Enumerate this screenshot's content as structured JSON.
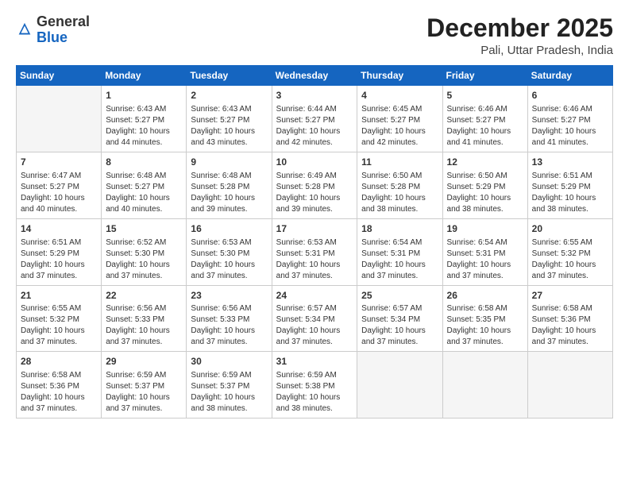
{
  "header": {
    "logo_general": "General",
    "logo_blue": "Blue",
    "month_title": "December 2025",
    "location": "Pali, Uttar Pradesh, India"
  },
  "weekdays": [
    "Sunday",
    "Monday",
    "Tuesday",
    "Wednesday",
    "Thursday",
    "Friday",
    "Saturday"
  ],
  "weeks": [
    [
      {
        "day": "",
        "empty": true
      },
      {
        "day": "1",
        "sunrise": "Sunrise: 6:43 AM",
        "sunset": "Sunset: 5:27 PM",
        "daylight": "Daylight: 10 hours and 44 minutes."
      },
      {
        "day": "2",
        "sunrise": "Sunrise: 6:43 AM",
        "sunset": "Sunset: 5:27 PM",
        "daylight": "Daylight: 10 hours and 43 minutes."
      },
      {
        "day": "3",
        "sunrise": "Sunrise: 6:44 AM",
        "sunset": "Sunset: 5:27 PM",
        "daylight": "Daylight: 10 hours and 42 minutes."
      },
      {
        "day": "4",
        "sunrise": "Sunrise: 6:45 AM",
        "sunset": "Sunset: 5:27 PM",
        "daylight": "Daylight: 10 hours and 42 minutes."
      },
      {
        "day": "5",
        "sunrise": "Sunrise: 6:46 AM",
        "sunset": "Sunset: 5:27 PM",
        "daylight": "Daylight: 10 hours and 41 minutes."
      },
      {
        "day": "6",
        "sunrise": "Sunrise: 6:46 AM",
        "sunset": "Sunset: 5:27 PM",
        "daylight": "Daylight: 10 hours and 41 minutes."
      }
    ],
    [
      {
        "day": "7",
        "sunrise": "Sunrise: 6:47 AM",
        "sunset": "Sunset: 5:27 PM",
        "daylight": "Daylight: 10 hours and 40 minutes."
      },
      {
        "day": "8",
        "sunrise": "Sunrise: 6:48 AM",
        "sunset": "Sunset: 5:27 PM",
        "daylight": "Daylight: 10 hours and 40 minutes."
      },
      {
        "day": "9",
        "sunrise": "Sunrise: 6:48 AM",
        "sunset": "Sunset: 5:28 PM",
        "daylight": "Daylight: 10 hours and 39 minutes."
      },
      {
        "day": "10",
        "sunrise": "Sunrise: 6:49 AM",
        "sunset": "Sunset: 5:28 PM",
        "daylight": "Daylight: 10 hours and 39 minutes."
      },
      {
        "day": "11",
        "sunrise": "Sunrise: 6:50 AM",
        "sunset": "Sunset: 5:28 PM",
        "daylight": "Daylight: 10 hours and 38 minutes."
      },
      {
        "day": "12",
        "sunrise": "Sunrise: 6:50 AM",
        "sunset": "Sunset: 5:29 PM",
        "daylight": "Daylight: 10 hours and 38 minutes."
      },
      {
        "day": "13",
        "sunrise": "Sunrise: 6:51 AM",
        "sunset": "Sunset: 5:29 PM",
        "daylight": "Daylight: 10 hours and 38 minutes."
      }
    ],
    [
      {
        "day": "14",
        "sunrise": "Sunrise: 6:51 AM",
        "sunset": "Sunset: 5:29 PM",
        "daylight": "Daylight: 10 hours and 37 minutes."
      },
      {
        "day": "15",
        "sunrise": "Sunrise: 6:52 AM",
        "sunset": "Sunset: 5:30 PM",
        "daylight": "Daylight: 10 hours and 37 minutes."
      },
      {
        "day": "16",
        "sunrise": "Sunrise: 6:53 AM",
        "sunset": "Sunset: 5:30 PM",
        "daylight": "Daylight: 10 hours and 37 minutes."
      },
      {
        "day": "17",
        "sunrise": "Sunrise: 6:53 AM",
        "sunset": "Sunset: 5:31 PM",
        "daylight": "Daylight: 10 hours and 37 minutes."
      },
      {
        "day": "18",
        "sunrise": "Sunrise: 6:54 AM",
        "sunset": "Sunset: 5:31 PM",
        "daylight": "Daylight: 10 hours and 37 minutes."
      },
      {
        "day": "19",
        "sunrise": "Sunrise: 6:54 AM",
        "sunset": "Sunset: 5:31 PM",
        "daylight": "Daylight: 10 hours and 37 minutes."
      },
      {
        "day": "20",
        "sunrise": "Sunrise: 6:55 AM",
        "sunset": "Sunset: 5:32 PM",
        "daylight": "Daylight: 10 hours and 37 minutes."
      }
    ],
    [
      {
        "day": "21",
        "sunrise": "Sunrise: 6:55 AM",
        "sunset": "Sunset: 5:32 PM",
        "daylight": "Daylight: 10 hours and 37 minutes."
      },
      {
        "day": "22",
        "sunrise": "Sunrise: 6:56 AM",
        "sunset": "Sunset: 5:33 PM",
        "daylight": "Daylight: 10 hours and 37 minutes."
      },
      {
        "day": "23",
        "sunrise": "Sunrise: 6:56 AM",
        "sunset": "Sunset: 5:33 PM",
        "daylight": "Daylight: 10 hours and 37 minutes."
      },
      {
        "day": "24",
        "sunrise": "Sunrise: 6:57 AM",
        "sunset": "Sunset: 5:34 PM",
        "daylight": "Daylight: 10 hours and 37 minutes."
      },
      {
        "day": "25",
        "sunrise": "Sunrise: 6:57 AM",
        "sunset": "Sunset: 5:34 PM",
        "daylight": "Daylight: 10 hours and 37 minutes."
      },
      {
        "day": "26",
        "sunrise": "Sunrise: 6:58 AM",
        "sunset": "Sunset: 5:35 PM",
        "daylight": "Daylight: 10 hours and 37 minutes."
      },
      {
        "day": "27",
        "sunrise": "Sunrise: 6:58 AM",
        "sunset": "Sunset: 5:36 PM",
        "daylight": "Daylight: 10 hours and 37 minutes."
      }
    ],
    [
      {
        "day": "28",
        "sunrise": "Sunrise: 6:58 AM",
        "sunset": "Sunset: 5:36 PM",
        "daylight": "Daylight: 10 hours and 37 minutes."
      },
      {
        "day": "29",
        "sunrise": "Sunrise: 6:59 AM",
        "sunset": "Sunset: 5:37 PM",
        "daylight": "Daylight: 10 hours and 37 minutes."
      },
      {
        "day": "30",
        "sunrise": "Sunrise: 6:59 AM",
        "sunset": "Sunset: 5:37 PM",
        "daylight": "Daylight: 10 hours and 38 minutes."
      },
      {
        "day": "31",
        "sunrise": "Sunrise: 6:59 AM",
        "sunset": "Sunset: 5:38 PM",
        "daylight": "Daylight: 10 hours and 38 minutes."
      },
      {
        "day": "",
        "empty": true
      },
      {
        "day": "",
        "empty": true
      },
      {
        "day": "",
        "empty": true
      }
    ]
  ]
}
